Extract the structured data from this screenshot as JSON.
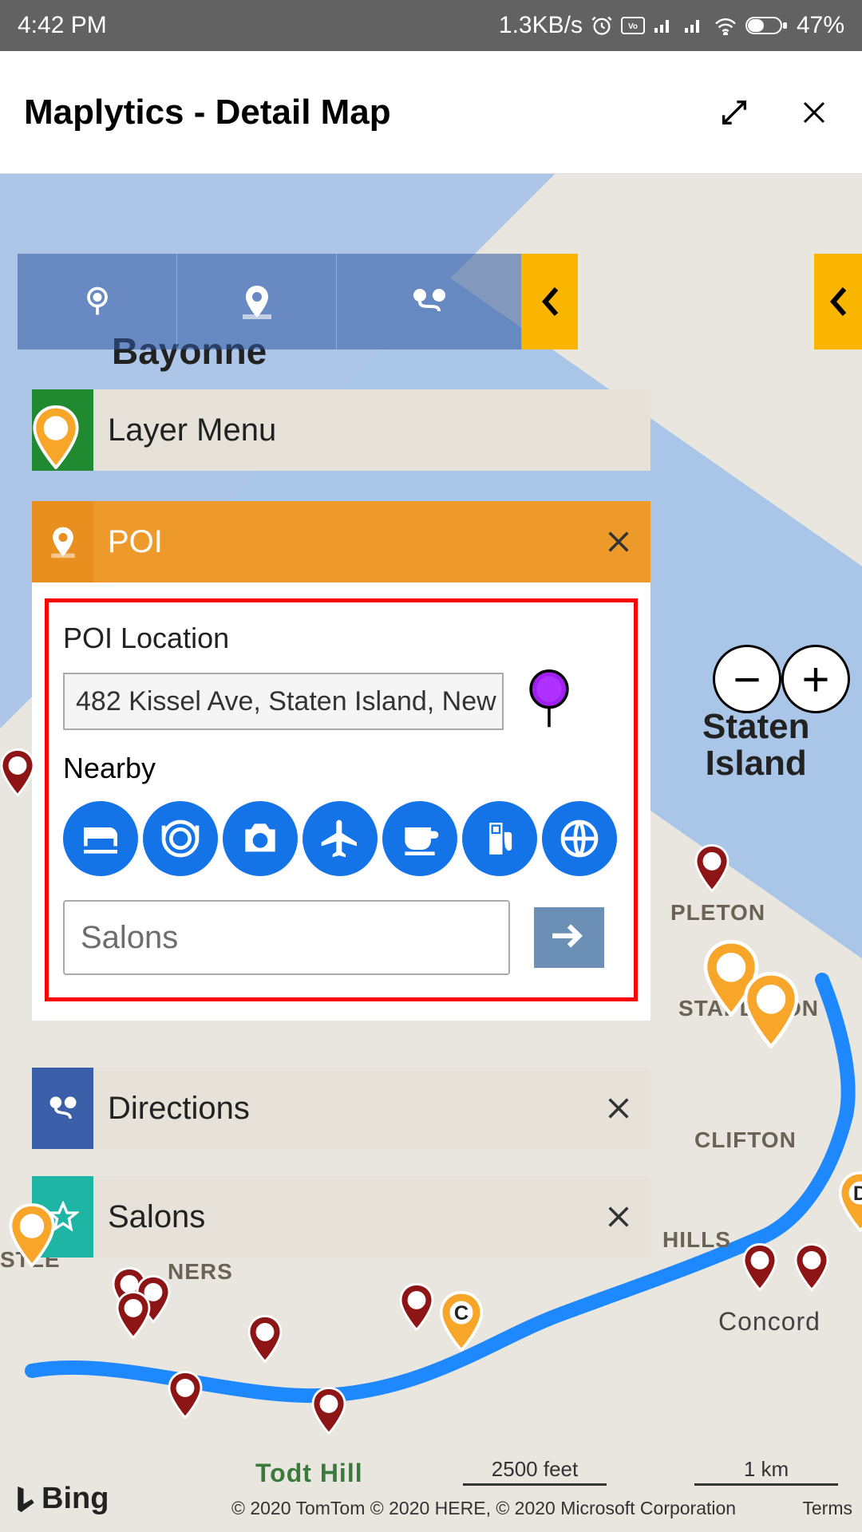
{
  "status": {
    "time": "4:42 PM",
    "rate": "1.3KB/s",
    "battery": "47%"
  },
  "header": {
    "title": "Maplytics - Detail Map"
  },
  "map": {
    "cities": {
      "bayonne": "Bayonne",
      "staten": "Staten\nIsland"
    },
    "areas": {
      "pleton": "PLETON",
      "stapleton": "STAPLETON",
      "clifton": "CLIFTON",
      "hills": "HILLS",
      "concord": "Concord",
      "todt": "Todt Hill",
      "ners": "NERS",
      "stle": "STLE"
    },
    "scale": {
      "feet": "2500 feet",
      "km": "1 km"
    },
    "brand": "Bing",
    "copyright": "© 2020 TomTom © 2020 HERE, © 2020 Microsoft Corporation",
    "terms": "Terms"
  },
  "panels": {
    "layer": {
      "title": "Layer Menu"
    },
    "poi": {
      "title": "POI",
      "location_label": "POI Location",
      "address": "482 Kissel Ave, Staten Island, New",
      "nearby_label": "Nearby",
      "search_value": "Salons"
    },
    "directions": {
      "title": "Directions"
    },
    "salons": {
      "title": "Salons"
    }
  },
  "nearby_icons": [
    "hotel",
    "restaurant",
    "camera",
    "airport",
    "coffee",
    "gas",
    "globe"
  ]
}
